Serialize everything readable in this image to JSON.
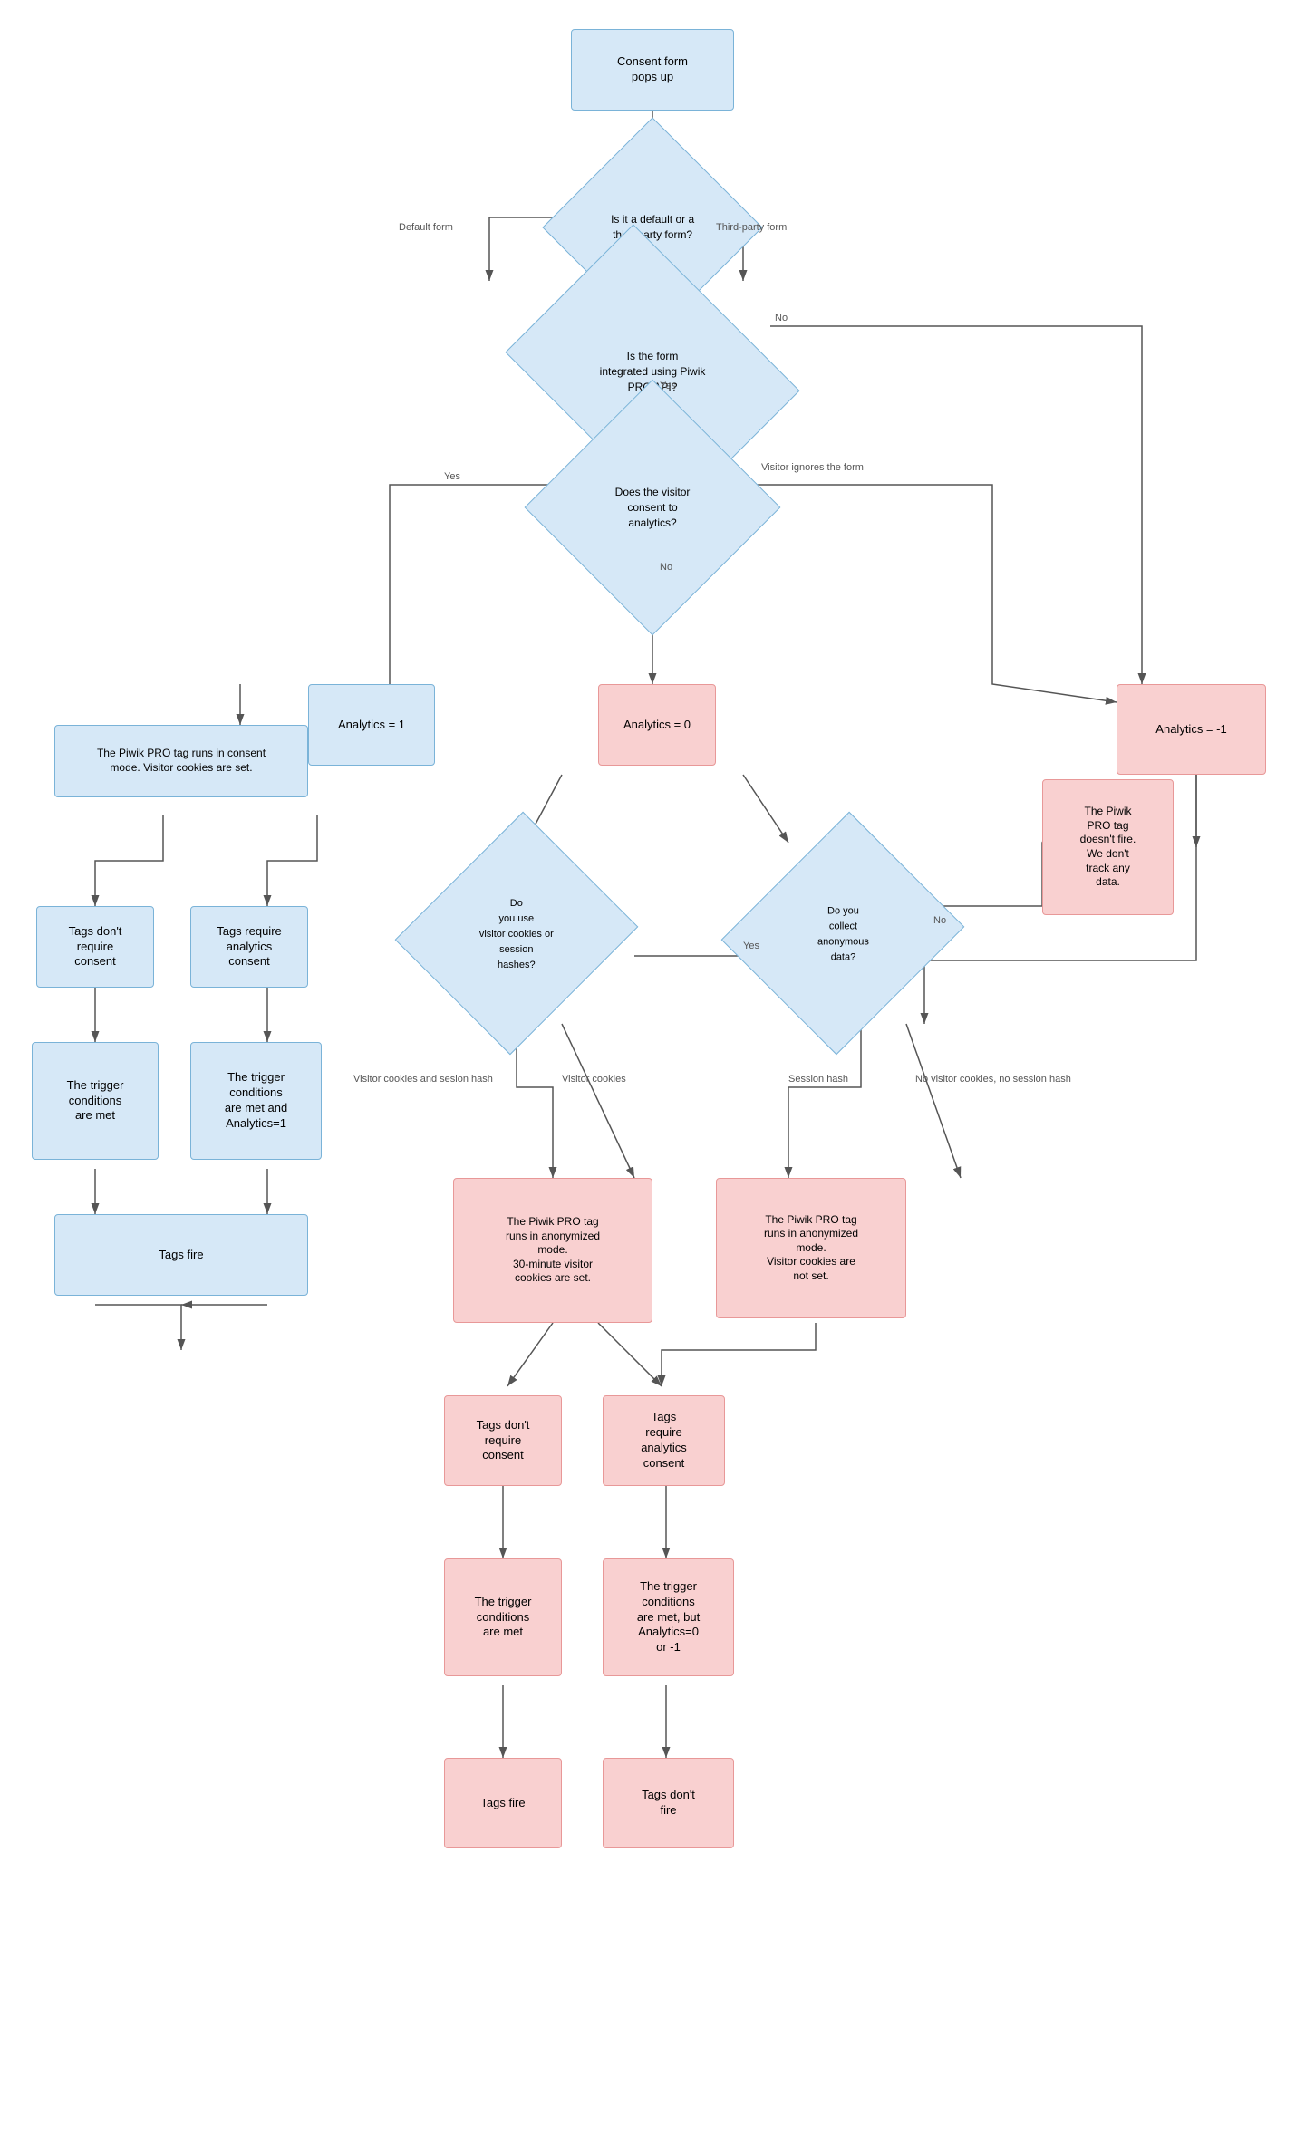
{
  "nodes": {
    "consent_form": {
      "label": "Consent form\npops up"
    },
    "default_or_third": {
      "label": "Is it a default or a\nthird-party form?"
    },
    "integrated_api": {
      "label": "Is the form\nintegrated using Piwik\nPRO API?"
    },
    "does_visitor_consent": {
      "label": "Does the visitor\nconsent to\nanalytics?"
    },
    "analytics_1": {
      "label": "Analytics = 1"
    },
    "analytics_neg1": {
      "label": "Analytics = -1"
    },
    "analytics_0": {
      "label": "Analytics = 0"
    },
    "piwik_consent_mode": {
      "label": "The Piwik PRO tag runs in consent\nmode. Visitor cookies are set."
    },
    "tags_no_consent": {
      "label": "Tags don't\nrequire\nconsent"
    },
    "tags_require_consent": {
      "label": "Tags require\nanalytics\nconsent"
    },
    "trigger_met": {
      "label": "The trigger\nconditions\nare met"
    },
    "trigger_met_analytics1": {
      "label": "The trigger\nconditions\nare met and\nAnalytics=1"
    },
    "tags_fire_left": {
      "label": "Tags fire"
    },
    "visitor_cookies_or_hashes": {
      "label": "Do\nyou use\nvisitor cookies or\nsession\nhashes?"
    },
    "collect_anonymous": {
      "label": "Do you\ncollect\nanonymous\ndata?"
    },
    "piwik_no_fire": {
      "label": "The Piwik\nPRO tag\ndoesn't fire.\nWe don't\ntrack any\ndata."
    },
    "piwik_anon_30min": {
      "label": "The Piwik PRO tag\nruns in anonymized\nmode.\n30-minute visitor\ncookies are set."
    },
    "piwik_anon_no_cookies": {
      "label": "The Piwik PRO tag\nruns in anonymized\nmode.\nVisitor cookies are\nnot set."
    },
    "tags_no_consent_b1": {
      "label": "Tags don't\nrequire\nconsent"
    },
    "tags_require_consent_b2": {
      "label": "Tags\nrequire\nanalytics\nconsent"
    },
    "trigger_met_b1": {
      "label": "The trigger\nconditions\nare met"
    },
    "trigger_met_but_b2": {
      "label": "The trigger\nconditions\nare met, but\nAnalytics=0\nor -1"
    },
    "tags_fire_b1": {
      "label": "Tags fire"
    },
    "tags_dont_fire_b2": {
      "label": "Tags don't\nfire"
    }
  },
  "labels": {
    "default_form": "Default form",
    "third_party_form": "Third-party form",
    "no_label": "No",
    "yes_label": "Yes",
    "visitor_ignores": "Visitor ignores the form",
    "no_answer": "No",
    "yes_answer": "Yes",
    "visitor_cookies_session": "Visitor cookies and sesion hash",
    "visitor_cookies": "Visitor cookies",
    "session_hash": "Session hash",
    "no_cookies_no_hash": "No visitor cookies, no session hash"
  }
}
